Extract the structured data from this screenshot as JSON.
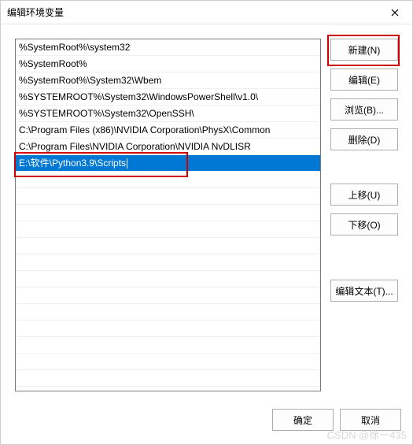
{
  "titlebar": {
    "title": "编辑环境变量"
  },
  "paths": [
    "%SystemRoot%\\system32",
    "%SystemRoot%",
    "%SystemRoot%\\System32\\Wbem",
    "%SYSTEMROOT%\\System32\\WindowsPowerShell\\v1.0\\",
    "%SYSTEMROOT%\\System32\\OpenSSH\\",
    "C:\\Program Files (x86)\\NVIDIA Corporation\\PhysX\\Common",
    "C:\\Program Files\\NVIDIA Corporation\\NVIDIA NvDLISR",
    "E:\\软件\\Python3.9\\Scripts"
  ],
  "selected_index": 7,
  "buttons": {
    "new_": "新建(N)",
    "edit": "编辑(E)",
    "browse": "浏览(B)...",
    "delete_": "删除(D)",
    "moveup": "上移(U)",
    "movedown": "下移(O)",
    "edittext": "编辑文本(T)...",
    "ok": "确定",
    "cancel": "取消"
  },
  "watermark": "CSDN @徐一435"
}
